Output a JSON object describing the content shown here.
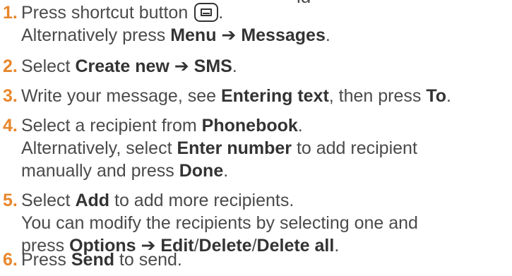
{
  "steps": [
    {
      "number": "1.",
      "lines": [
        {
          "t1": "Press shortcut button ",
          "t2": "."
        },
        {
          "t1": "Alternatively press ",
          "k1": "Menu",
          "arrow": " ➔ ",
          "k2": "Messages",
          "t2": "."
        }
      ]
    },
    {
      "number": "2.",
      "lines": [
        {
          "t1": "Select ",
          "k1": "Create new",
          "arrow": " ➔ ",
          "k2": "SMS",
          "t2": "."
        }
      ]
    },
    {
      "number": "3.",
      "lines": [
        {
          "t1": "Write your message, see ",
          "k1": "Entering text",
          "t2": ", then press ",
          "k2": "To",
          "t3": "."
        }
      ]
    },
    {
      "number": "4.",
      "lines": [
        {
          "t1": "Select a recipient from ",
          "k1": "Phonebook",
          "t2": "."
        },
        {
          "t1": "Alternatively, select ",
          "k1": "Enter number",
          "t2": " to add recipient"
        },
        {
          "t1": "manually and press ",
          "k1": "Done",
          "t2": "."
        }
      ]
    },
    {
      "number": "5.",
      "lines": [
        {
          "t1": "Select ",
          "k1": "Add",
          "t2": " to add more recipients."
        },
        {
          "t1": "You can modify the recipients by selecting one and"
        },
        {
          "t1": "press ",
          "k1": "Options",
          "arrow": " ➔ ",
          "k2": "Edit",
          "s1": "/",
          "k3": "Delete",
          "s2": "/",
          "k4": "Delete all",
          "t2": "."
        }
      ]
    },
    {
      "number": "6.",
      "lines": [
        {
          "t1": "Press ",
          "k1": "Send",
          "t2": " to send."
        }
      ]
    }
  ],
  "icons": {
    "shortcut_button": "message-envelope-key-icon"
  },
  "colors": {
    "step_number": "#e8862b",
    "body_text": "#4a4a4a",
    "keyword": "#333333"
  }
}
